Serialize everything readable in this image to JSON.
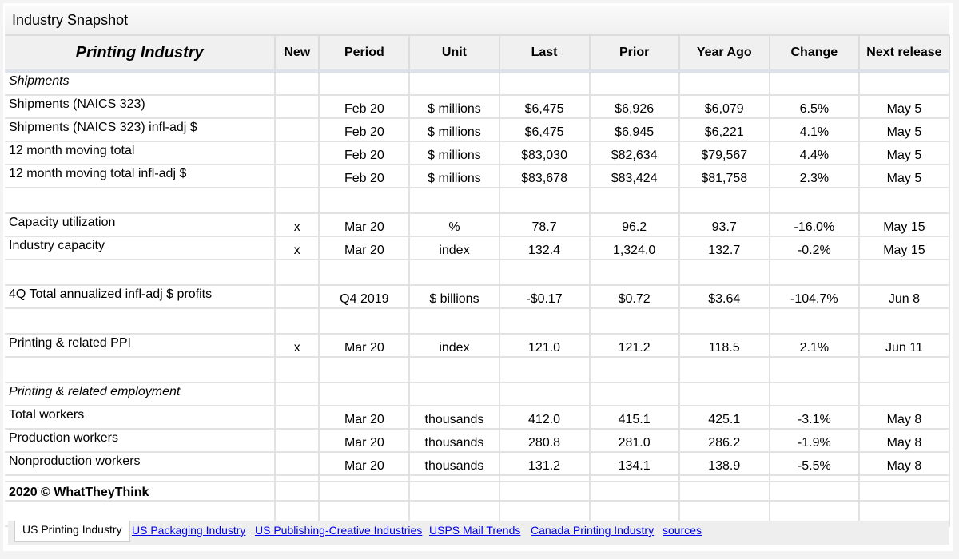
{
  "title": "Industry Snapshot",
  "table": {
    "headers": [
      "Printing Industry",
      "New",
      "Period",
      "Unit",
      "Last",
      "Prior",
      "Year Ago",
      "Change",
      "Next release"
    ],
    "rows": [
      {
        "type": "section",
        "label": "Shipments",
        "new": "",
        "period": "",
        "unit": "",
        "last": "",
        "prior": "",
        "year_ago": "",
        "change": "",
        "next": ""
      },
      {
        "type": "data",
        "label": "Shipments (NAICS 323)",
        "new": "",
        "period": "Feb 20",
        "unit": "$ millions",
        "last": "$6,475",
        "prior": "$6,926",
        "year_ago": "$6,079",
        "change": "6.5%",
        "next": "May 5"
      },
      {
        "type": "data",
        "label": "Shipments (NAICS 323) infl-adj $",
        "new": "",
        "period": "Feb 20",
        "unit": "$ millions",
        "last": "$6,475",
        "prior": "$6,945",
        "year_ago": "$6,221",
        "change": "4.1%",
        "next": "May 5"
      },
      {
        "type": "data",
        "label": "12 month moving total",
        "new": "",
        "period": "Feb 20",
        "unit": "$ millions",
        "last": "$83,030",
        "prior": "$82,634",
        "year_ago": "$79,567",
        "change": "4.4%",
        "next": "May 5"
      },
      {
        "type": "data",
        "label": "12 month moving total infl-adj $",
        "new": "",
        "period": "Feb 20",
        "unit": "$ millions",
        "last": "$83,678",
        "prior": "$83,424",
        "year_ago": "$81,758",
        "change": "2.3%",
        "next": "May 5"
      },
      {
        "type": "blank",
        "label": "",
        "new": "",
        "period": "",
        "unit": "",
        "last": "",
        "prior": "",
        "year_ago": "",
        "change": "",
        "next": ""
      },
      {
        "type": "data",
        "label": "Capacity utilization",
        "new": "x",
        "period": "Mar 20",
        "unit": "%",
        "last": "78.7",
        "prior": "96.2",
        "year_ago": "93.7",
        "change": "-16.0%",
        "next": "May 15"
      },
      {
        "type": "data",
        "label": "Industry capacity",
        "new": "x",
        "period": "Mar 20",
        "unit": "index",
        "last": "132.4",
        "prior": "1,324.0",
        "year_ago": "132.7",
        "change": "-0.2%",
        "next": "May 15"
      },
      {
        "type": "blank",
        "label": "",
        "new": "",
        "period": "",
        "unit": "",
        "last": "",
        "prior": "",
        "year_ago": "",
        "change": "",
        "next": ""
      },
      {
        "type": "data",
        "label": "4Q Total annualized infl-adj $ profits",
        "new": "",
        "period": "Q4 2019",
        "unit": "$ billions",
        "last": "-$0.17",
        "prior": "$0.72",
        "year_ago": "$3.64",
        "change": "-104.7%",
        "next": "Jun 8"
      },
      {
        "type": "blank",
        "label": "",
        "new": "",
        "period": "",
        "unit": "",
        "last": "",
        "prior": "",
        "year_ago": "",
        "change": "",
        "next": ""
      },
      {
        "type": "data",
        "label": "Printing & related PPI",
        "new": "x",
        "period": "Mar 20",
        "unit": "index",
        "last": "121.0",
        "prior": "121.2",
        "year_ago": "118.5",
        "change": "2.1%",
        "next": "Jun 11"
      },
      {
        "type": "blank",
        "label": "",
        "new": "",
        "period": "",
        "unit": "",
        "last": "",
        "prior": "",
        "year_ago": "",
        "change": "",
        "next": ""
      },
      {
        "type": "section",
        "label": "Printing & related employment",
        "new": "",
        "period": "",
        "unit": "",
        "last": "",
        "prior": "",
        "year_ago": "",
        "change": "",
        "next": ""
      },
      {
        "type": "data",
        "label": "Total workers",
        "new": "",
        "period": "Mar 20",
        "unit": "thousands",
        "last": "412.0",
        "prior": "415.1",
        "year_ago": "425.1",
        "change": "-3.1%",
        "next": "May 8"
      },
      {
        "type": "data",
        "label": "Production workers",
        "new": "",
        "period": "Mar 20",
        "unit": "thousands",
        "last": "280.8",
        "prior": "281.0",
        "year_ago": "286.2",
        "change": "-1.9%",
        "next": "May 8"
      },
      {
        "type": "data",
        "label": "Nonproduction workers",
        "new": "",
        "period": "Mar 20",
        "unit": "thousands",
        "last": "131.2",
        "prior": "134.1",
        "year_ago": "138.9",
        "change": "-5.5%",
        "next": "May 8"
      },
      {
        "type": "blank",
        "label": "",
        "new": "",
        "period": "",
        "unit": "",
        "last": "",
        "prior": "",
        "year_ago": "",
        "change": "",
        "next": ""
      },
      {
        "type": "blank",
        "label": "",
        "new": "",
        "period": "",
        "unit": "",
        "last": "",
        "prior": "",
        "year_ago": "",
        "change": "",
        "next": ""
      }
    ]
  },
  "footer": {
    "copyright": "2020 © WhatTheyThink"
  },
  "tabs": {
    "active": "US Printing Industry",
    "links": [
      "US Packaging Industry",
      "US Publishing-Creative Industries",
      "USPS Mail Trends",
      "Canada Printing Industry",
      "sources"
    ]
  },
  "colors": {
    "link": "#0000ee",
    "header_bg": "#f0f0f0",
    "grid": "#e2e2e2"
  }
}
